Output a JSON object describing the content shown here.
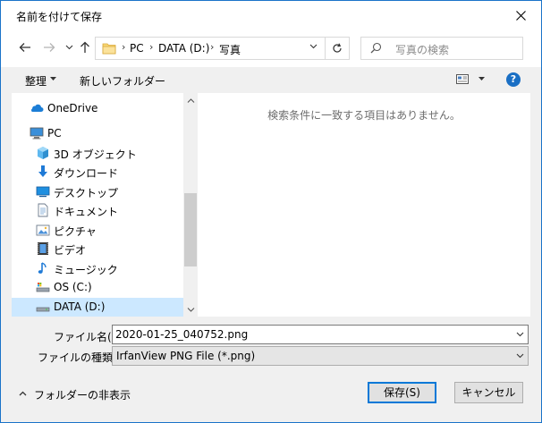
{
  "window": {
    "title": "名前を付けて保存",
    "accent": "#1a73c9"
  },
  "nav": {
    "back_icon": "arrow-left-icon",
    "forward_icon": "arrow-right-icon",
    "recent_icon": "chevron-down-icon",
    "up_icon": "arrow-up-icon",
    "breadcrumb": [
      "PC",
      "DATA (D:)",
      "写真"
    ],
    "refresh_icon": "refresh-icon",
    "search_placeholder": "写真の検索"
  },
  "toolbar": {
    "organize_label": "整理",
    "new_folder_label": "新しいフォルダー",
    "help_label": "?"
  },
  "tree": [
    {
      "label": "OneDrive",
      "icon": "onedrive-icon"
    },
    {
      "label": "PC",
      "icon": "pc-icon"
    },
    {
      "label": "3D オブジェクト",
      "icon": "3d-objects-icon"
    },
    {
      "label": "ダウンロード",
      "icon": "download-icon"
    },
    {
      "label": "デスクトップ",
      "icon": "desktop-icon"
    },
    {
      "label": "ドキュメント",
      "icon": "documents-icon"
    },
    {
      "label": "ピクチャ",
      "icon": "pictures-icon"
    },
    {
      "label": "ビデオ",
      "icon": "videos-icon"
    },
    {
      "label": "ミュージック",
      "icon": "music-icon"
    },
    {
      "label": "OS (C:)",
      "icon": "drive-c-icon"
    },
    {
      "label": "DATA (D:)",
      "icon": "drive-d-icon",
      "selected": true
    }
  ],
  "file_pane": {
    "empty_message": "検索条件に一致する項目はありません。"
  },
  "form": {
    "filename_label": "ファイル名(N):",
    "filename_value": "2020-01-25_040752.png",
    "filetype_label": "ファイルの種類(T):",
    "filetype_value": "IrfanView PNG File (*.png)"
  },
  "footer": {
    "hide_folders_label": "フォルダーの非表示",
    "save_label": "保存(S)",
    "cancel_label": "キャンセル"
  }
}
